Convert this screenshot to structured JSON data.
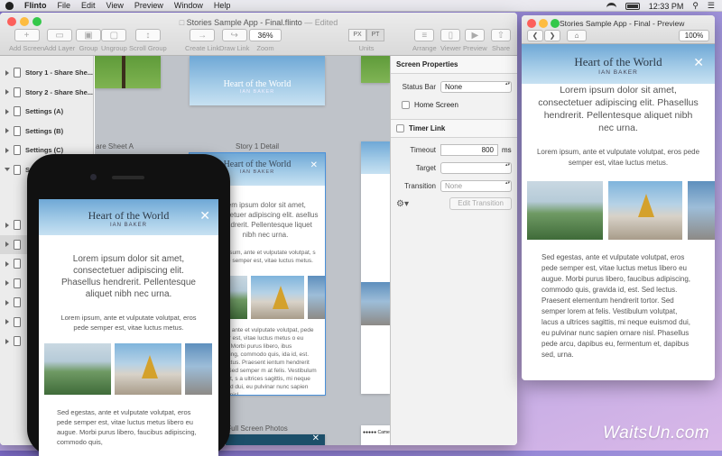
{
  "menubar": {
    "app_name": "Flinto",
    "items": [
      "File",
      "Edit",
      "View",
      "Preview",
      "Window",
      "Help"
    ],
    "clock": "12:33 PM"
  },
  "main_window": {
    "title": "Stories Sample App - Final.flinto",
    "edited": "— Edited",
    "toolbar": {
      "add_screen": "Add Screen",
      "add_layer": "Add Layer",
      "group": "Group",
      "ungroup": "Ungroup",
      "scroll_group": "Scroll Group",
      "create_link": "Create Link",
      "draw_link": "Draw Link",
      "zoom_value": "36%",
      "zoom_label": "Zoom",
      "units_px": "PX",
      "units_pt": "PT",
      "units_label": "Units",
      "arrange": "Arrange",
      "viewer": "Viewer",
      "preview": "Preview",
      "share": "Share"
    }
  },
  "sidebar": {
    "items": [
      {
        "label": "Story 1 - Share She..."
      },
      {
        "label": "Story 2 - Share She..."
      },
      {
        "label": "Settings (A)"
      },
      {
        "label": "Settings (B)"
      },
      {
        "label": "Settings (C)"
      },
      {
        "label": "Stor"
      }
    ]
  },
  "canvas": {
    "card_labels": {
      "share_sheet_a": "are Sheet A",
      "story1_detail": "Story 1 Detail",
      "full_screen_photos": "Full Screen Photos",
      "camera": "●●●●● Came"
    },
    "story_title": "Heart of the World",
    "story_author": "IAN BAKER"
  },
  "properties": {
    "screen_properties": "Screen Properties",
    "status_bar_label": "Status Bar",
    "status_bar_value": "None",
    "home_screen": "Home Screen",
    "timer_link": "Timer Link",
    "timeout_label": "Timeout",
    "timeout_value": "800",
    "timeout_unit": "ms",
    "target_label": "Target",
    "transition_label": "Transition",
    "transition_value": "None",
    "edit_transition": "Edit Transition"
  },
  "preview_window": {
    "title": "Stories Sample App - Final - Preview",
    "zoom": "100%"
  },
  "story": {
    "title": "Heart of the World",
    "author": "IAN BAKER",
    "intro": "Lorem ipsum dolor sit amet, consectetuer adipiscing elit. Phasellus hendrerit. Pellentesque aliquet nibh nec urna.",
    "para1": "Lorem ipsum, ante et vulputate volutpat, eros pede semper est, vitae luctus metus.",
    "para2_preview": "Sed egestas, ante et vulputate volutpat, eros pede semper est, vitae luctus metus libero eu augue. Morbi purus libero, faucibus adipiscing, commodo quis, gravida id, est. Sed lectus. Praesent elementum hendrerit tortor. Sed semper lorem at felis. Vestibulum volutpat, lacus a ultrices sagittis, mi neque euismod dui, eu pulvinar nunc sapien ornare nisl. Phasellus pede arcu, dapibus eu, fermentum et, dapibus sed, urna.",
    "para2_phone": "Sed egestas, ante et vulputate volutpat, eros pede semper est, vitae luctus metus libero eu augue. Morbi purus libero, faucibus adipiscing, commodo quis,",
    "para2_canvas": "gestas, ante et vulputate volutpat, pede semper est, vitae luctus metus o eu augue. Morbi purus libero, ibus adipiscing, commodo quis, ida id, est. Sed lectus. Praesent ientum hendrerit tortor. Sed semper m at felis. Vestibulum volutpat, s a ultrices sagittis, mi neque euismod dui, eu pulvinar nunc sapien ornare nisl.",
    "intro_canvas": "rem ipsum dolor sit amet, nsectetuer adipiscing elit. asellus hendrerit. Pellentesque liquet nibh nec urna.",
    "para1_canvas": "em ipsum, ante et vulputate volutpat, s pede semper est, vitae luctus metus."
  },
  "watermark": "WaitsUn.com",
  "colors": {
    "accent": "#4a90d9",
    "hero_sky": "#8fbde0"
  }
}
